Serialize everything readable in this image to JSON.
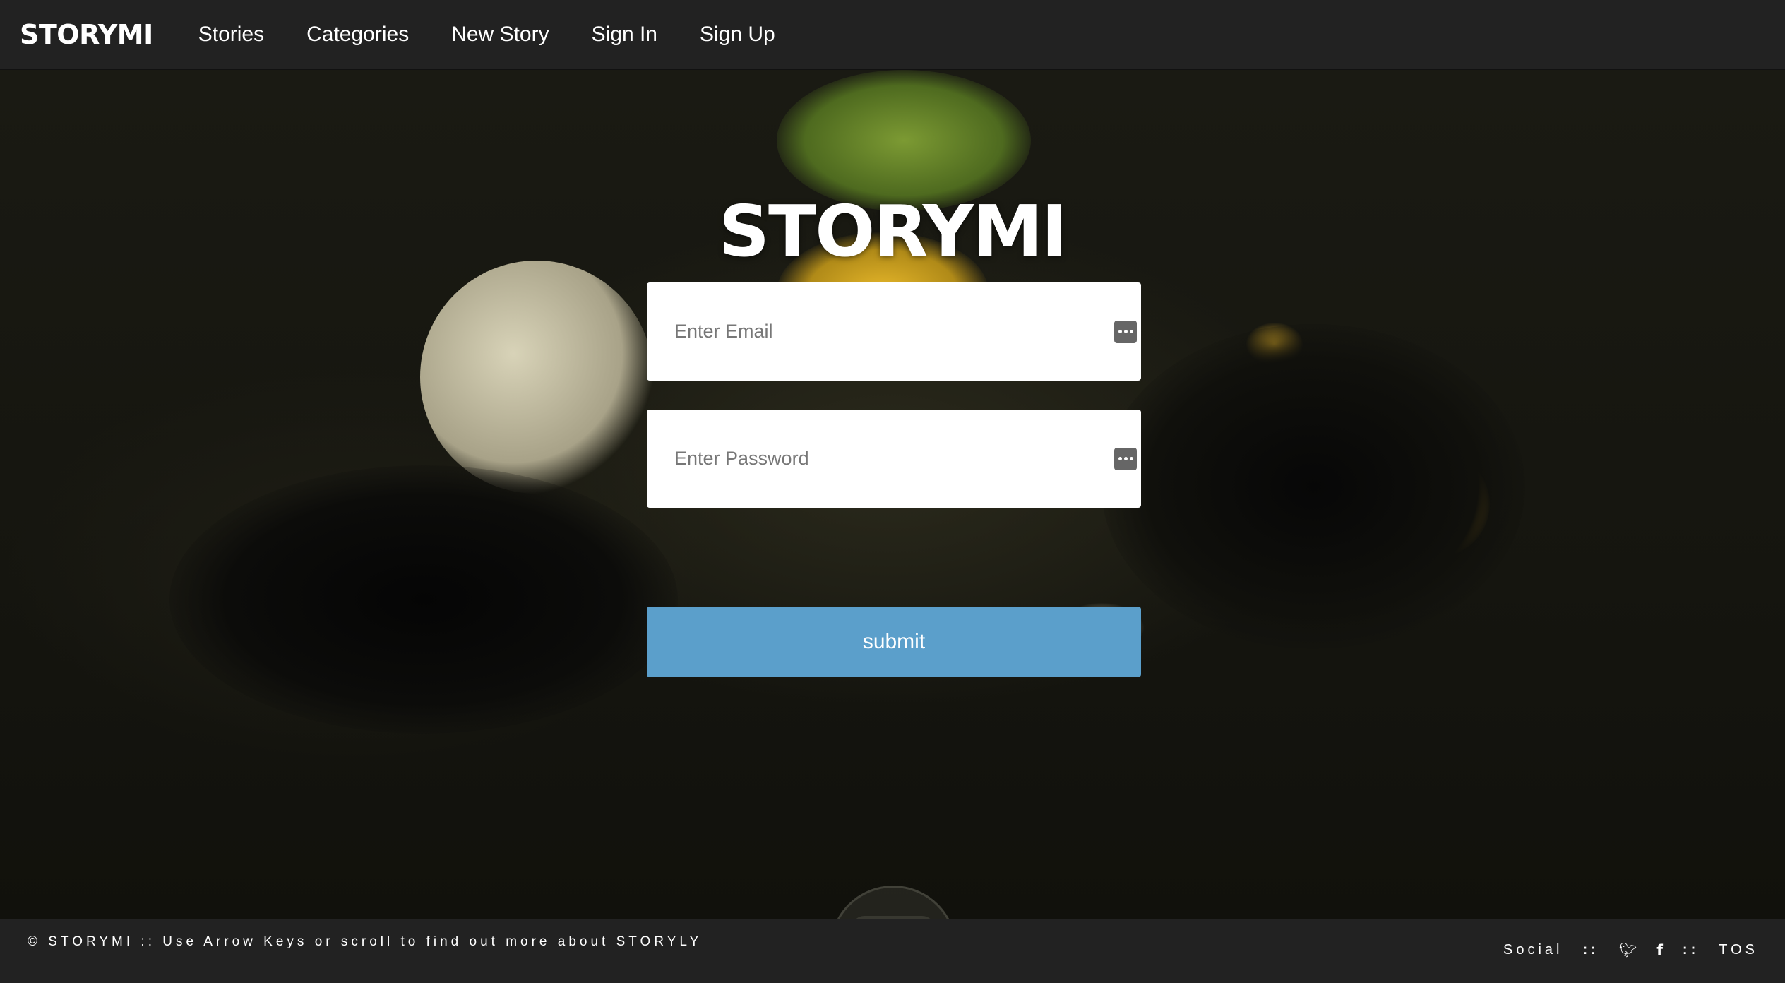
{
  "nav": {
    "brand": "STORYMI",
    "links": [
      "Stories",
      "Categories",
      "New Story",
      "Sign In",
      "Sign Up"
    ]
  },
  "hero": {
    "title": "STORYMI"
  },
  "form": {
    "email_placeholder": "Enter Email",
    "password_placeholder": "Enter Password",
    "submit_label": "submit"
  },
  "footer": {
    "copyright": "© STORYMI :: Use Arrow Keys or scroll to find out more about STORYLY",
    "social_label": "Social",
    "separator": "::",
    "twitter_icon": "twitter-icon",
    "facebook_icon": "facebook-icon",
    "tos_label": "TOS"
  },
  "colors": {
    "nav_bg": "#222222",
    "submit_bg": "#5b9fcb",
    "accent_yellow": "#e8b527"
  }
}
